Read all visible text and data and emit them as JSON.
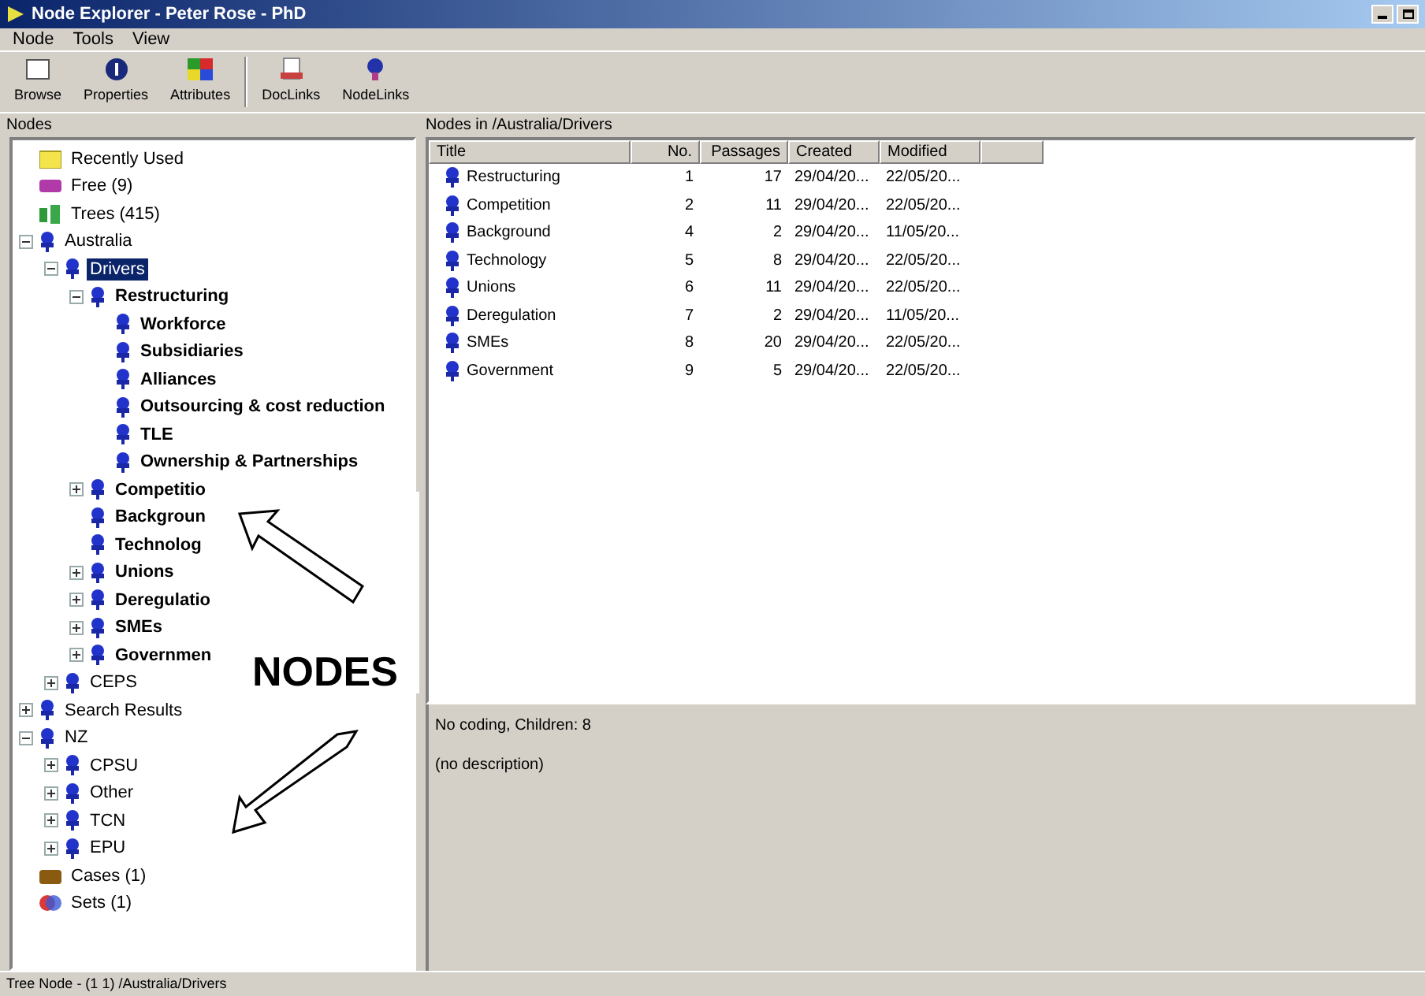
{
  "window": {
    "title": "Node Explorer - Peter Rose - PhD"
  },
  "menu": [
    "Node",
    "Tools",
    "View"
  ],
  "toolbar": [
    {
      "label": "Browse",
      "kind": "browse"
    },
    {
      "label": "Properties",
      "kind": "properties"
    },
    {
      "label": "Attributes",
      "kind": "attributes"
    },
    {
      "label": "DocLinks",
      "kind": "doclinks"
    },
    {
      "label": "NodeLinks",
      "kind": "nodelinks"
    }
  ],
  "left_header": "Nodes",
  "right_header": "Nodes in /Australia/Drivers",
  "tree": [
    {
      "label": "Recently Used",
      "kind": "folder"
    },
    {
      "label": "Free (9)",
      "kind": "free"
    },
    {
      "label": "Trees (415)",
      "kind": "trees"
    },
    {
      "label": "Australia",
      "kind": "node",
      "expanded": true,
      "children": [
        {
          "label": "Drivers",
          "kind": "node",
          "expanded": true,
          "selected": true,
          "children": [
            {
              "label": "Restructuring",
              "kind": "node",
              "bold": true,
              "expanded": true,
              "children": [
                {
                  "label": "Workforce",
                  "kind": "node",
                  "bold": true
                },
                {
                  "label": "Subsidiaries",
                  "kind": "node",
                  "bold": true
                },
                {
                  "label": "Alliances",
                  "kind": "node",
                  "bold": true
                },
                {
                  "label": "Outsourcing & cost reduction",
                  "kind": "node",
                  "bold": true
                },
                {
                  "label": "TLE",
                  "kind": "node",
                  "bold": true
                },
                {
                  "label": "Ownership & Partnerships",
                  "kind": "node",
                  "bold": true
                }
              ]
            },
            {
              "label": "Competitio",
              "kind": "node",
              "bold": true,
              "expanded": false
            },
            {
              "label": "Backgroun",
              "kind": "node",
              "bold": true
            },
            {
              "label": "Technolog",
              "kind": "node",
              "bold": true
            },
            {
              "label": "Unions",
              "kind": "node",
              "bold": true,
              "expanded": false
            },
            {
              "label": "Deregulatio",
              "kind": "node",
              "bold": true,
              "expanded": false
            },
            {
              "label": "SMEs",
              "kind": "node",
              "bold": true,
              "expanded": false
            },
            {
              "label": "Governmen",
              "kind": "node",
              "bold": true,
              "expanded": false
            }
          ]
        },
        {
          "label": "CEPS",
          "kind": "node",
          "expanded": false
        }
      ]
    },
    {
      "label": "Search Results",
      "kind": "node",
      "expanded": false
    },
    {
      "label": "NZ",
      "kind": "node",
      "expanded": true,
      "children": [
        {
          "label": "CPSU",
          "kind": "node",
          "expanded": false
        },
        {
          "label": "Other",
          "kind": "node",
          "expanded": false
        },
        {
          "label": "TCN",
          "kind": "node",
          "expanded": false
        },
        {
          "label": "EPU",
          "kind": "node",
          "expanded": false
        }
      ]
    },
    {
      "label": "Cases (1)",
      "kind": "cases"
    },
    {
      "label": "Sets (1)",
      "kind": "sets"
    }
  ],
  "table": {
    "columns": [
      "Title",
      "No.",
      "Passages",
      "Created",
      "Modified"
    ],
    "rows": [
      [
        "Restructuring",
        "1",
        "17",
        "29/04/20...",
        "22/05/20..."
      ],
      [
        "Competition",
        "2",
        "11",
        "29/04/20...",
        "22/05/20..."
      ],
      [
        "Background",
        "4",
        "2",
        "29/04/20...",
        "11/05/20..."
      ],
      [
        "Technology",
        "5",
        "8",
        "29/04/20...",
        "22/05/20..."
      ],
      [
        "Unions",
        "6",
        "11",
        "29/04/20...",
        "22/05/20..."
      ],
      [
        "Deregulation",
        "7",
        "2",
        "29/04/20...",
        "11/05/20..."
      ],
      [
        "SMEs",
        "8",
        "20",
        "29/04/20...",
        "22/05/20..."
      ],
      [
        "Government",
        "9",
        "5",
        "29/04/20...",
        "22/05/20..."
      ]
    ]
  },
  "details": [
    "No coding, Children: 8",
    "(no description)"
  ],
  "status_bar": "Tree Node - (1 1) /Australia/Drivers",
  "annotation": {
    "label": "NODES"
  }
}
